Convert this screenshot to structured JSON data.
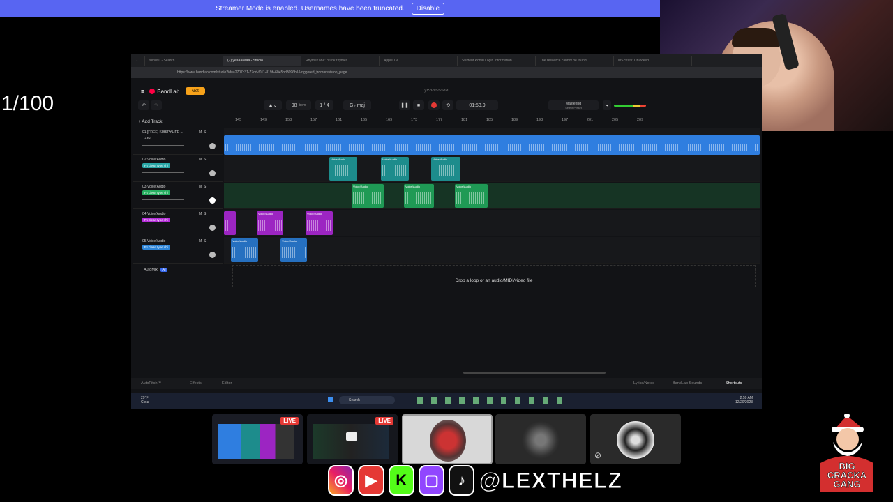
{
  "banner": {
    "text": "Streamer Mode is enabled. Usernames have been truncated.",
    "button": "Disable"
  },
  "counter": "1/100",
  "browser": {
    "tabs": [
      "sendsu - Search",
      "(2) yeaaaaaaa - Studio",
      "RhymeZone: drunk rhymes",
      "Apple TV",
      "Student Portal Login Information",
      "The resource cannot be found",
      "MS Stats: Unlocked"
    ],
    "url": "https://www.bandlab.com/studio?id=a2707c31-77dd-f011-819b-6045bd3096b1&triggered_from=revision_page"
  },
  "bandlab": {
    "logo": "BandLab",
    "get_label": "Get",
    "project_title": "yeaaaaaaa",
    "bpm_value": "98",
    "bpm_unit": "bpm",
    "time_sig": "1 / 4",
    "key": "G♭ maj",
    "time": "01:53.9",
    "mastering": "Mastering",
    "mastering_sub": "Select Preset",
    "add_track": "Add Track",
    "ruler": [
      "145",
      "149",
      "153",
      "157",
      "161",
      "165",
      "169",
      "173",
      "177",
      "181",
      "185",
      "189",
      "193",
      "197",
      "201",
      "205",
      "209"
    ],
    "tracks": [
      {
        "name": "01 [FREE] KIBSPYLIFE ...",
        "fx": "+ Fx",
        "color": "#3a8ee8"
      },
      {
        "name": "02 Voice/Audio",
        "fx": "Fx clean type shi",
        "color": "#2aa7a7"
      },
      {
        "name": "03 Voice/Audio",
        "fx": "Fx clean type shi",
        "color": "#27b061"
      },
      {
        "name": "04 Voice/Audio",
        "fx": "Fx clean type shi",
        "color": "#b62fd9"
      },
      {
        "name": "05 Voice/Audio",
        "fx": "Fx clean type shi",
        "color": "#2f86d9"
      }
    ],
    "clip_label": "Voice/Audio",
    "ms": {
      "m": "M",
      "s": "S"
    },
    "automix": "AutoMix",
    "automix_badge": "AI",
    "drop_text": "Drop a loop or an audio/MIDI/video file",
    "bottom": {
      "autopitch": "AutoPitch™",
      "effects": "Effects",
      "editor": "Editor",
      "lyrics": "Lyrics/Notes",
      "sounds": "BandLab Sounds",
      "shortcuts": "Shortcuts"
    }
  },
  "taskbar": {
    "weather_temp": "29°F",
    "weather_desc": "Clear",
    "search": "Search",
    "time": "2:59 AM",
    "date": "12/20/2023"
  },
  "thumbs": {
    "live": "LIVE"
  },
  "social": {
    "handle": "@LEXTHELZ"
  },
  "santa": {
    "line1": "BIG",
    "line2": "CRACKA",
    "line3": "GANG"
  }
}
